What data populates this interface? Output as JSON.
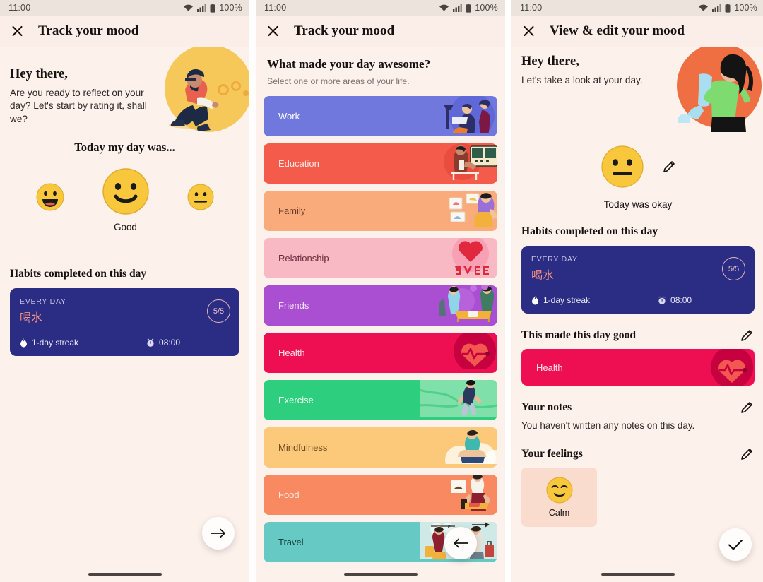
{
  "statusbar": {
    "time": "11:00",
    "battery": "100%",
    "wifi_icon": "wifi-icon",
    "signal_icon": "signal-icon",
    "battery_icon": "battery-icon"
  },
  "screen1": {
    "appbar": {
      "title": "Track your mood",
      "close_icon": "close-icon"
    },
    "hero": {
      "heading": "Hey there,",
      "body": "Are you ready to reflect on your day? Let's start by rating it, shall we?",
      "illustration": "man-kneeling-juggling-coins-illustration"
    },
    "mood_question": "Today my day was...",
    "moods": [
      {
        "key": "great",
        "emoji": "grinning-face",
        "label": "",
        "selected": false,
        "size": 40
      },
      {
        "key": "good",
        "emoji": "slightly-smiling-face",
        "label": "Good",
        "selected": true,
        "size": 68
      },
      {
        "key": "okay",
        "emoji": "neutral-face",
        "label": "",
        "selected": false,
        "size": 38
      }
    ],
    "habits_heading": "Habits completed on this day",
    "habit": {
      "frequency": "EVERY DAY",
      "name": "喝水",
      "progress": "5/5",
      "streak": "1-day streak",
      "time": "08:00",
      "streak_icon": "flame-icon",
      "time_icon": "alarm-clock-icon",
      "card_color": "#2b2d84",
      "name_color": "#f5907f"
    },
    "fab": {
      "icon": "arrow-right-icon",
      "name": "next-button"
    }
  },
  "screen2": {
    "appbar": {
      "title": "Track your mood",
      "close_icon": "close-icon"
    },
    "title": "What made your day awesome?",
    "subtitle": "Select one or more areas of your life.",
    "categories": [
      {
        "label": "Work",
        "bg": "#7178dd",
        "text": "#ffffff",
        "art": "work-desk-illustration"
      },
      {
        "label": "Education",
        "bg": "#f45b4a",
        "text": "#fde7e3",
        "art": "teacher-board-illustration"
      },
      {
        "label": "Family",
        "bg": "#f9ab7c",
        "text": "#6b3b2a",
        "art": "family-photos-illustration"
      },
      {
        "label": "Relationship",
        "bg": "#f9b9c4",
        "text": "#6b2c3a",
        "art": "love-heart-illustration"
      },
      {
        "label": "Friends",
        "bg": "#ab4fd2",
        "text": "#f6e6fb",
        "art": "friends-table-illustration"
      },
      {
        "label": "Health",
        "bg": "#ed0f52",
        "text": "#ffe0ea",
        "art": "heart-pulse-illustration"
      },
      {
        "label": "Exercise",
        "bg": "#2dce7e",
        "text": "#effdf4",
        "art": "running-person-illustration"
      },
      {
        "label": "Mindfulness",
        "bg": "#fbc979",
        "text": "#6b4a1c",
        "art": "meditating-person-illustration"
      },
      {
        "label": "Food",
        "bg": "#f98961",
        "text": "#fff0e8",
        "art": "cooking-person-illustration"
      },
      {
        "label": "Travel",
        "bg": "#66c9c3",
        "text": "#14423f",
        "art": "travellers-illustration"
      }
    ],
    "fab": {
      "icon": "arrow-left-icon",
      "name": "back-button"
    }
  },
  "screen3": {
    "appbar": {
      "title": "View & edit your mood",
      "close_icon": "close-icon"
    },
    "hero": {
      "heading": "Hey there,",
      "body": "Let's take a look at your day.",
      "illustration": "woman-reading-list-illustration"
    },
    "mood": {
      "emoji": "neutral-face",
      "caption": "Today was okay",
      "edit_icon": "pencil-icon"
    },
    "habits_heading": "Habits completed on this day",
    "habit": {
      "frequency": "EVERY DAY",
      "name": "喝水",
      "progress": "5/5",
      "streak": "1-day streak",
      "time": "08:00",
      "streak_icon": "flame-icon",
      "time_icon": "alarm-clock-icon"
    },
    "good_heading": "This made this day good",
    "good_edit_icon": "pencil-icon",
    "good_chip": {
      "label": "Health",
      "bg": "#ed0f52",
      "art": "heart-pulse-illustration"
    },
    "notes_heading": "Your notes",
    "notes_edit_icon": "pencil-icon",
    "notes_empty": "You haven't written any notes on this day.",
    "feelings_heading": "Your feelings",
    "feelings_edit_icon": "pencil-icon",
    "feelings": [
      {
        "label": "Calm",
        "emoji": "relieved-face"
      }
    ],
    "fab": {
      "icon": "check-icon",
      "name": "confirm-button"
    }
  },
  "theme": {
    "background": "#fdf1ec",
    "appbar_bg": "#fbeee8",
    "statusbar_bg": "#ece3dc",
    "text_primary": "#15110f",
    "accent_navy": "#2b2d84"
  }
}
